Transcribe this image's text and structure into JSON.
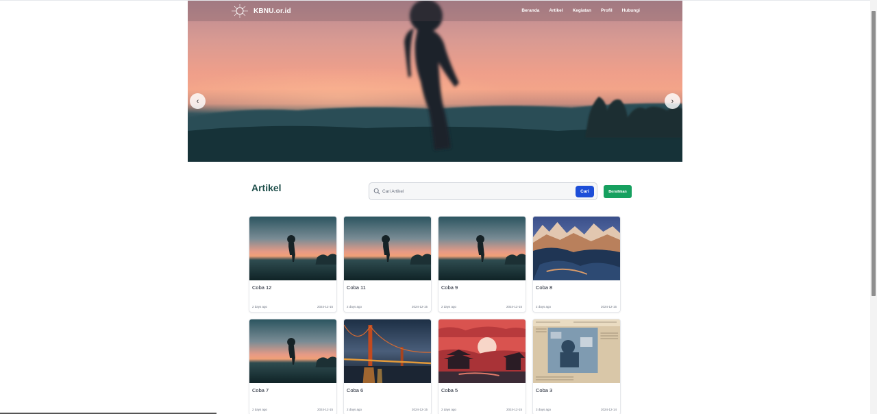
{
  "brand": {
    "name": "KBNU.or.id"
  },
  "nav": {
    "items": [
      "Beranda",
      "Artikel",
      "Kegiatan",
      "Profil",
      "Hubungi"
    ]
  },
  "carousel": {
    "prev_icon": "chevron-left-icon",
    "next_icon": "chevron-right-icon",
    "prev_glyph": "‹",
    "next_glyph": "›"
  },
  "section": {
    "title": "Artikel"
  },
  "search": {
    "placeholder": "Cari Artikel",
    "value": "",
    "button_label": "Cari",
    "clear_label": "Bersihkan"
  },
  "articles": [
    {
      "title": "Coba 12",
      "ago": "2 days ago",
      "date": "2024-12-15",
      "image": "silhouette-sunset"
    },
    {
      "title": "Coba 11",
      "ago": "2 days ago",
      "date": "2024-12-15",
      "image": "silhouette-sunset"
    },
    {
      "title": "Coba 9",
      "ago": "2 days ago",
      "date": "2024-12-15",
      "image": "silhouette-sunset"
    },
    {
      "title": "Coba 8",
      "ago": "2 days ago",
      "date": "2024-12-15",
      "image": "snowy-mountains"
    },
    {
      "title": "Coba 7",
      "ago": "2 days ago",
      "date": "2024-12-15",
      "image": "silhouette-sunset"
    },
    {
      "title": "Coba 6",
      "ago": "2 days ago",
      "date": "2024-12-15",
      "image": "golden-gate-night"
    },
    {
      "title": "Coba 5",
      "ago": "2 days ago",
      "date": "2024-12-15",
      "image": "red-pagoda-art"
    },
    {
      "title": "Coba 3",
      "ago": "3 days ago",
      "date": "2024-12-14",
      "image": "newspaper-photo"
    }
  ],
  "colors": {
    "accent_blue": "#1d4ed8",
    "accent_green": "#16a05f",
    "title_teal": "#1e4e4a"
  }
}
